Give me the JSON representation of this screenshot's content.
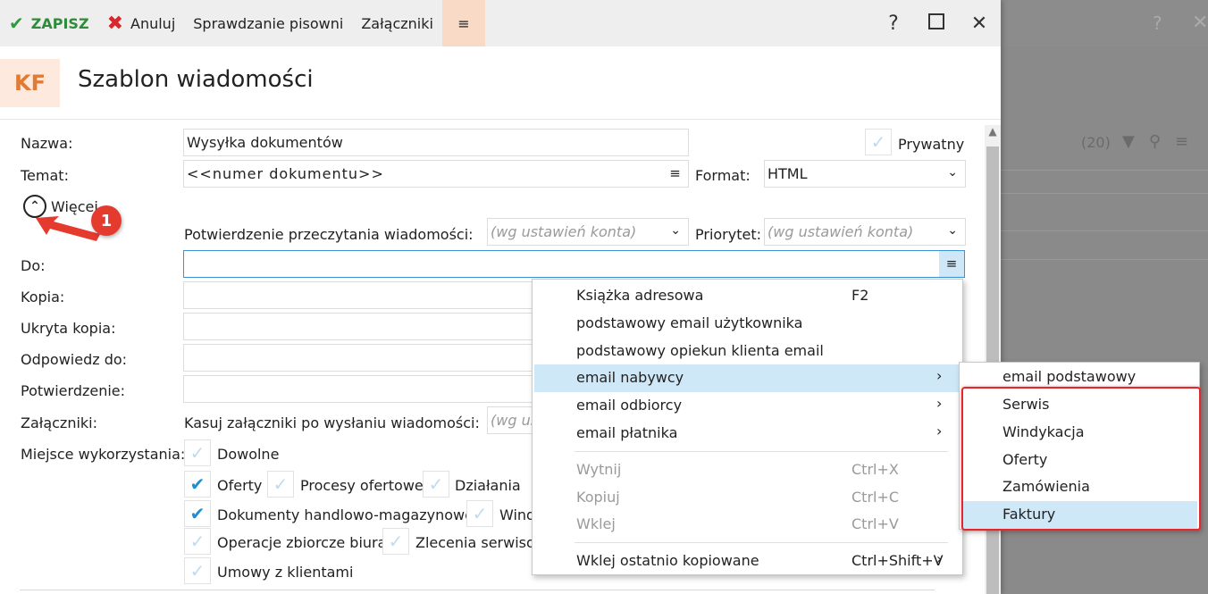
{
  "toolbar": {
    "save_label": "ZAPISZ",
    "cancel_label": "Anuluj",
    "spellcheck_label": "Sprawdzanie pisowni",
    "attachments_label": "Załączniki",
    "menu_icon": "≡",
    "help": "?",
    "close": "✕"
  },
  "header": {
    "badge": "KF",
    "title": "Szablon wiadomości"
  },
  "background": {
    "count": "(20)",
    "help": "?",
    "close": "✕"
  },
  "form": {
    "name_label": "Nazwa:",
    "name_value": "Wysyłka dokumentów",
    "private_label": "Prywatny",
    "subject_label": "Temat:",
    "subject_value": "<<numer dokumentu>>",
    "format_label": "Format:",
    "format_value": "HTML",
    "more_label": "Więcej",
    "read_receipt_label": "Potwierdzenie przeczytania wiadomości:",
    "read_receipt_value": "(wg ustawień konta)",
    "priority_label": "Priorytet:",
    "priority_value": "(wg ustawień konta)",
    "to_label": "Do:",
    "to_value": "",
    "cc_label": "Kopia:",
    "bcc_label": "Ukryta kopia:",
    "reply_to_label": "Odpowiedz do:",
    "confirm_label": "Potwierdzenie:",
    "attachments_label": "Załączniki:",
    "delete_attachments_label": "Kasuj załączniki po wysłaniu wiadomości:",
    "delete_attachments_value": "(wg us",
    "usage_label": "Miejsce wykorzystania:",
    "usage": {
      "anywhere": "Dowolne",
      "offers": "Oferty",
      "offer_processes": "Procesy ofertowe",
      "actions": "Działania",
      "trade_docs": "Dokumenty handlowo-magazynowe",
      "windykacja_partial": "Wind",
      "bulk_ops": "Operacje zbiorcze biura",
      "service_orders": "Zlecenia serwisow",
      "contracts": "Umowy z klientami"
    }
  },
  "annotation": {
    "number": "1"
  },
  "context_menu": {
    "items": [
      {
        "label": "Książka adresowa",
        "shortcut": "F2"
      },
      {
        "label": "podstawowy email użytkownika"
      },
      {
        "label": "podstawowy opiekun klienta email"
      },
      {
        "label": "email nabywcy",
        "submenu": "›"
      },
      {
        "label": "email odbiorcy",
        "submenu": "›"
      },
      {
        "label": "email płatnika",
        "submenu": "›"
      },
      {
        "label": "Wytnij",
        "shortcut": "Ctrl+X"
      },
      {
        "label": "Kopiuj",
        "shortcut": "Ctrl+C"
      },
      {
        "label": "Wklej",
        "shortcut": "Ctrl+V"
      },
      {
        "label": "Wklej ostatnio kopiowane",
        "shortcut": "Ctrl+Shift+V",
        "submenu": "›"
      }
    ]
  },
  "submenu": {
    "items": [
      "email podstawowy",
      "Serwis",
      "Windykacja",
      "Oferty",
      "Zamówienia",
      "Faktury"
    ]
  }
}
